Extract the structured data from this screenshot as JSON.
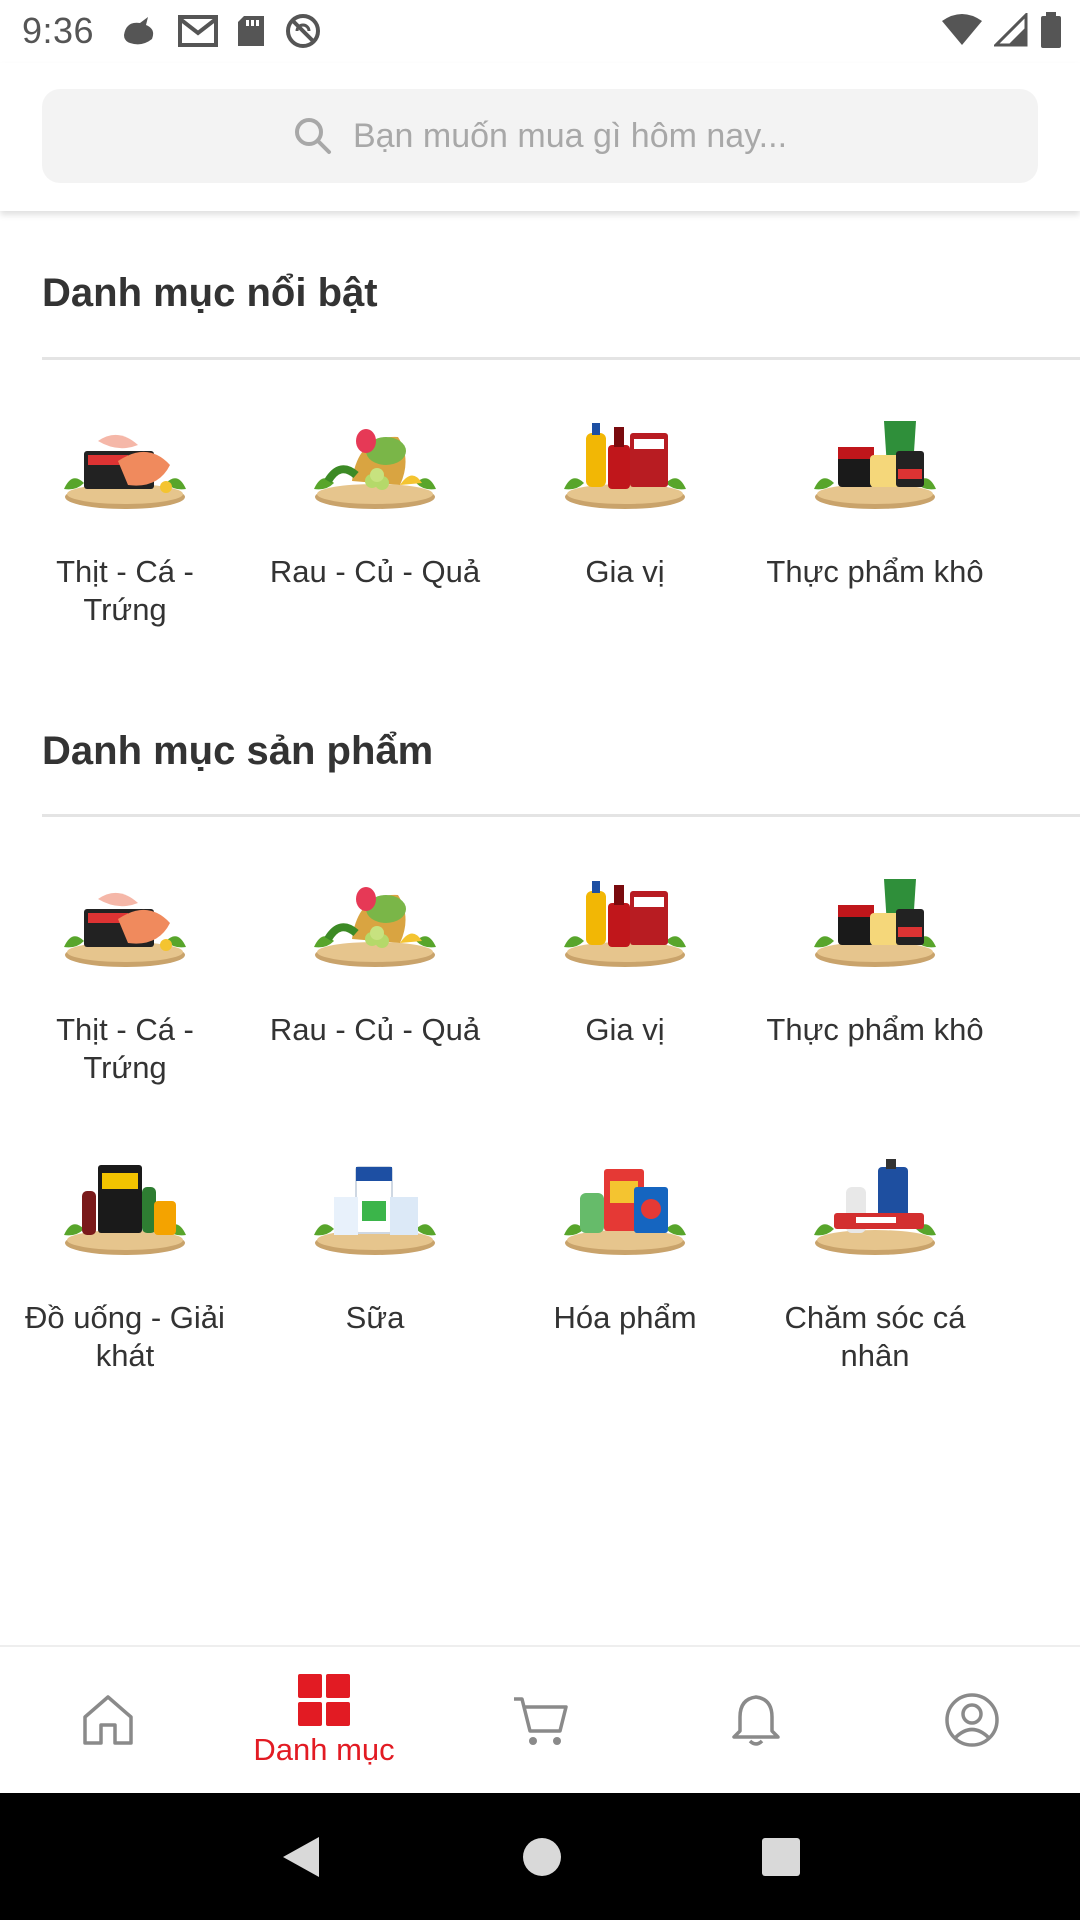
{
  "status_bar": {
    "time": "9:36",
    "left_icons": [
      "bird-icon",
      "gmail-icon",
      "sd-card-icon",
      "no-sync-icon"
    ],
    "right_icons": [
      "wifi-icon",
      "signal-icon",
      "battery-icon"
    ]
  },
  "search": {
    "placeholder": "Bạn muốn mua gì hôm nay..."
  },
  "featured": {
    "title": "Danh mục nổi bật",
    "items": [
      {
        "label": "Thịt - Cá - Trứng",
        "icon": "meat-fish-egg-icon"
      },
      {
        "label": "Rau - Củ - Quả",
        "icon": "vegetables-fruits-icon"
      },
      {
        "label": "Gia vị",
        "icon": "spices-icon"
      },
      {
        "label": "Thực phẩm khô",
        "icon": "dry-food-icon"
      }
    ]
  },
  "products": {
    "title": "Danh mục sản phẩm",
    "items": [
      {
        "label": "Thịt - Cá - Trứng",
        "icon": "meat-fish-egg-icon"
      },
      {
        "label": "Rau - Củ - Quả",
        "icon": "vegetables-fruits-icon"
      },
      {
        "label": "Gia vị",
        "icon": "spices-icon"
      },
      {
        "label": "Thực phẩm khô",
        "icon": "dry-food-icon"
      },
      {
        "label": "Đồ uống - Giải khát",
        "icon": "beverages-icon"
      },
      {
        "label": "Sữa",
        "icon": "milk-icon"
      },
      {
        "label": "Hóa phẩm",
        "icon": "detergent-icon"
      },
      {
        "label": "Chăm sóc cá nhân",
        "icon": "personal-care-icon"
      }
    ]
  },
  "bottom_nav": {
    "active_label": "Danh mục",
    "items": [
      "home-icon",
      "category-icon",
      "cart-icon",
      "bell-icon",
      "account-icon"
    ]
  },
  "colors": {
    "accent": "#e21b23",
    "inactive_icon": "#8a8a8a",
    "search_bg": "#f3f3f3"
  }
}
